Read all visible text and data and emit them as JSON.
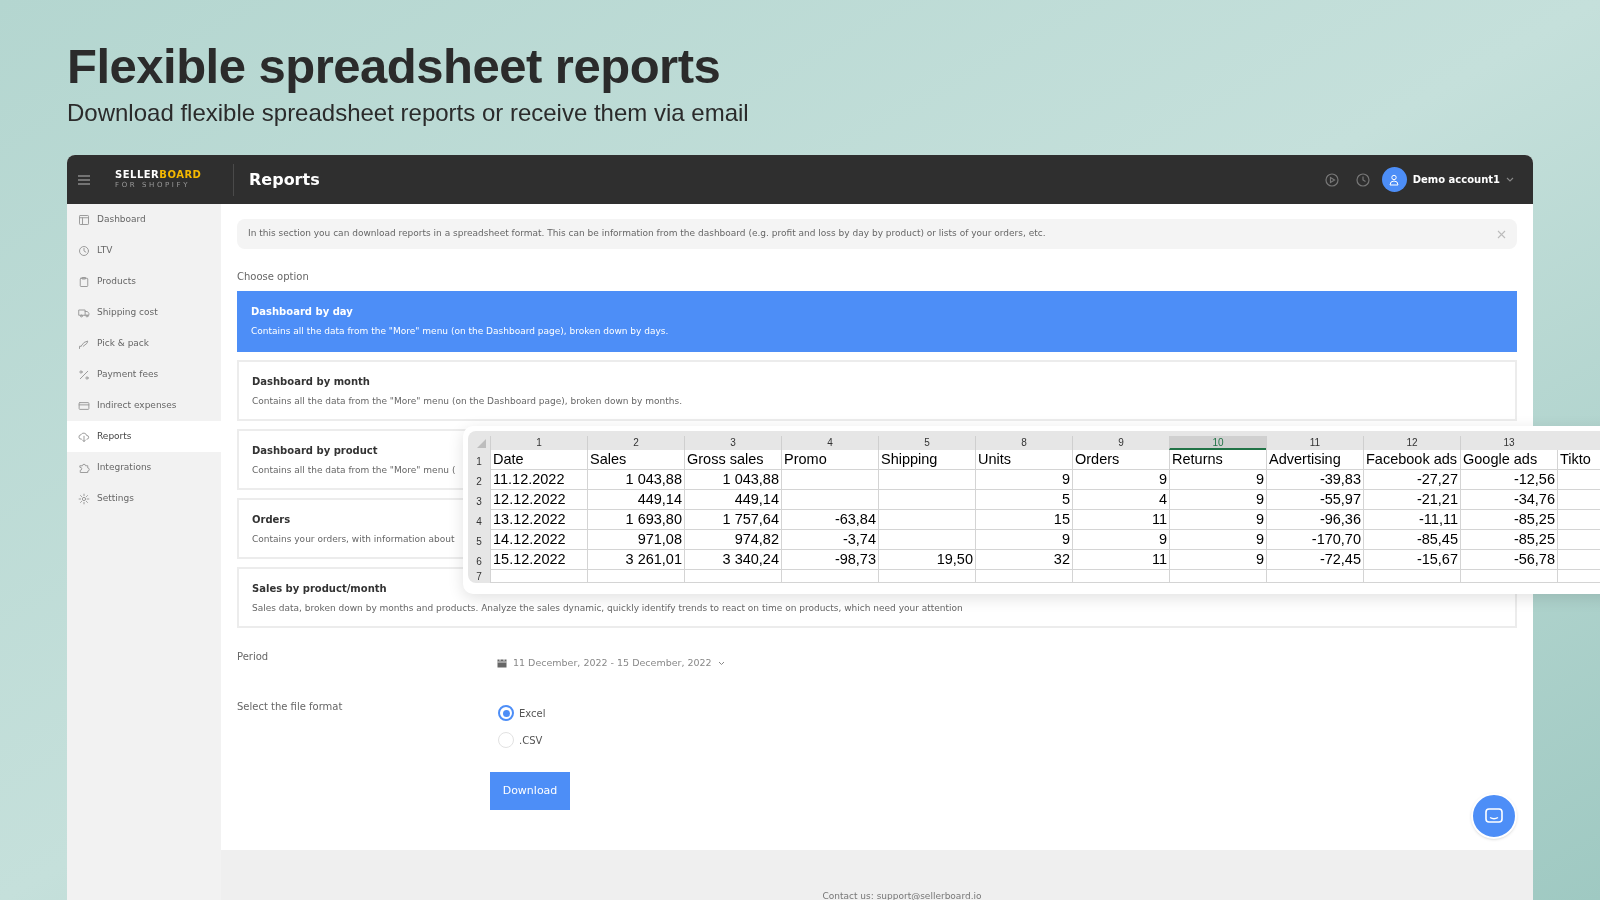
{
  "hero": {
    "title": "Flexible spreadsheet reports",
    "subtitle": "Download flexible spreadsheet reports or receive them via email"
  },
  "app": {
    "logo": {
      "first": "SELLER",
      "accent": "BOARD",
      "tagline": "FOR SHOPIFY"
    },
    "page_title": "Reports",
    "account": "Demo account1"
  },
  "sidebar": {
    "items": [
      {
        "label": "Dashboard",
        "selected": false
      },
      {
        "label": "LTV",
        "selected": false
      },
      {
        "label": "Products",
        "selected": false
      },
      {
        "label": "Shipping cost",
        "selected": false
      },
      {
        "label": "Pick & pack",
        "selected": false
      },
      {
        "label": "Payment fees",
        "selected": false
      },
      {
        "label": "Indirect expenses",
        "selected": false
      },
      {
        "label": "Reports",
        "selected": true
      },
      {
        "label": "Integrations",
        "selected": false
      },
      {
        "label": "Settings",
        "selected": false
      }
    ]
  },
  "info": "In this section you can download reports in a spreadsheet format. This can be information from the dashboard (e.g. profit and loss by day by product) or lists of your orders, etc.",
  "choose_label": "Choose option",
  "options": [
    {
      "title": "Dashboard by day",
      "description": "Contains all the data from the \"More\" menu (on the Dashboard page), broken down by days.",
      "selected": true
    },
    {
      "title": "Dashboard by month",
      "description": "Contains all the data from the \"More\" menu (on the Dashboard page), broken down by months.",
      "selected": false
    },
    {
      "title": "Dashboard by product",
      "description": "Contains all the data from the \"More\" menu (",
      "selected": false
    },
    {
      "title": "Orders",
      "description": "Contains your orders, with information about",
      "selected": false
    },
    {
      "title": "Sales by product/month",
      "description": "Sales data, broken down by months and products. Analyze the sales dynamic, quickly identify trends to react on time on products, which need your attention",
      "selected": false
    }
  ],
  "period": {
    "label": "Period",
    "value": "11 December, 2022 - 15 December, 2022"
  },
  "file_format": {
    "label": "Select the file format",
    "options": [
      {
        "label": "Excel",
        "selected": true
      },
      {
        "label": ".CSV",
        "selected": false
      }
    ]
  },
  "download_button": "Download",
  "footer": "Contact us: support@sellerboard.io",
  "spreadsheet": {
    "columns": [
      {
        "label": "1",
        "selected": false
      },
      {
        "label": "2",
        "selected": false
      },
      {
        "label": "3",
        "selected": false
      },
      {
        "label": "4",
        "selected": false
      },
      {
        "label": "5",
        "selected": false
      },
      {
        "label": "8",
        "selected": false
      },
      {
        "label": "9",
        "selected": false
      },
      {
        "label": "10",
        "selected": true
      },
      {
        "label": "11",
        "selected": false
      },
      {
        "label": "12",
        "selected": false
      },
      {
        "label": "13",
        "selected": false
      }
    ],
    "rows": [
      {
        "number": "1",
        "cells": [
          "Date",
          "Sales",
          "Gross sales",
          "Promo",
          "Shipping",
          "Units",
          "Orders",
          "Returns",
          "Advertising",
          "Facebook ads",
          "Google ads",
          "Tikto"
        ]
      },
      {
        "number": "2",
        "cells": [
          "11.12.2022",
          "1 043,88",
          "1 043,88",
          null,
          null,
          "9",
          "9",
          "9",
          "-39,83",
          "-27,27",
          "-12,56",
          null
        ]
      },
      {
        "number": "3",
        "cells": [
          "12.12.2022",
          "449,14",
          "449,14",
          null,
          null,
          "5",
          "4",
          "9",
          "-55,97",
          "-21,21",
          "-34,76",
          null
        ]
      },
      {
        "number": "4",
        "cells": [
          "13.12.2022",
          "1 693,80",
          "1 757,64",
          "-63,84",
          null,
          "15",
          "11",
          "9",
          "-96,36",
          "-11,11",
          "-85,25",
          null
        ]
      },
      {
        "number": "5",
        "cells": [
          "14.12.2022",
          "971,08",
          "974,82",
          "-3,74",
          null,
          "9",
          "9",
          "9",
          "-170,70",
          "-85,45",
          "-85,25",
          null
        ]
      },
      {
        "number": "6",
        "cells": [
          "15.12.2022",
          "3 261,01",
          "3 340,24",
          "-98,73",
          "19,50",
          "32",
          "11",
          "9",
          "-72,45",
          "-15,67",
          "-56,78",
          null
        ]
      },
      {
        "number": "7"
      }
    ]
  }
}
